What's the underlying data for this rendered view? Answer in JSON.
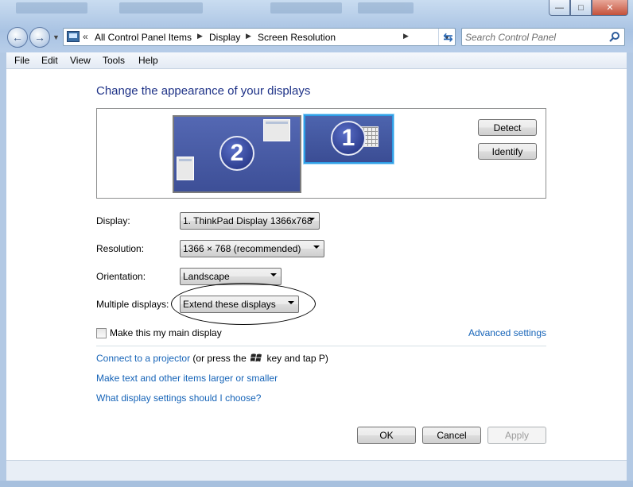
{
  "navigation": {
    "breadcrumb": [
      "All Control Panel Items",
      "Display",
      "Screen Resolution"
    ],
    "overflow_glyph": "«",
    "search_placeholder": "Search Control Panel"
  },
  "window_controls": {
    "minimize": "—",
    "maximize": "□",
    "close": "✕"
  },
  "menubar": [
    "File",
    "Edit",
    "View",
    "Tools",
    "Help"
  ],
  "title": "Change the appearance of your displays",
  "preview": {
    "monitor_2_number": "2",
    "monitor_1_number": "1",
    "detect_label": "Detect",
    "identify_label": "Identify"
  },
  "fields": {
    "display_label": "Display:",
    "display_value": "1. ThinkPad Display 1366x768",
    "resolution_label": "Resolution:",
    "resolution_value": "1366 × 768 (recommended)",
    "orientation_label": "Orientation:",
    "orientation_value": "Landscape",
    "multiple_label": "Multiple displays:",
    "multiple_value": "Extend these displays"
  },
  "main_display": {
    "label": "Make this my main display",
    "checked": false
  },
  "advanced_settings": "Advanced settings",
  "projector": {
    "link": "Connect to a projector",
    "text_before": "(or press the",
    "text_after": "key and tap P)"
  },
  "links": {
    "larger": "Make text and other items larger or smaller",
    "choose": "What display settings should I choose?"
  },
  "buttons": {
    "ok": "OK",
    "cancel": "Cancel",
    "apply": "Apply"
  },
  "colors": {
    "title": "#1e3287",
    "link": "#1664b8",
    "monitor_selected_border": "#2e9fe6"
  }
}
